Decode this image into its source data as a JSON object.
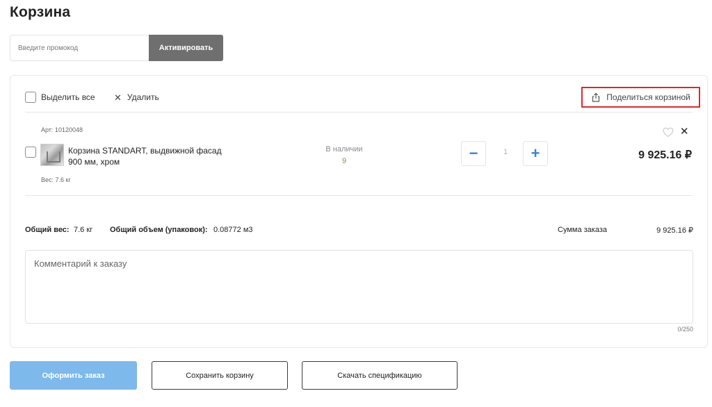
{
  "page": {
    "title": "Корзина"
  },
  "promo": {
    "placeholder": "Введите промокод",
    "button_label": "Активировать"
  },
  "toolbar": {
    "select_all_label": "Выделить все",
    "delete_label": "Удалить",
    "share_label": "Поделиться корзиной"
  },
  "item": {
    "article": "Арт: 10120048",
    "name": "Корзина STANDART, выдвижной фасад 900 мм, хром",
    "weight": "Вес: 7.6 кг",
    "stock_status": "В наличии",
    "stock_count": "9",
    "quantity": "1",
    "price": "9 925.16 ₽",
    "icons": {
      "favorite": "heart-outline-icon",
      "remove": "close-icon"
    }
  },
  "summary": {
    "weight_label": "Общий вес:",
    "weight_value": "7.6 кг",
    "volume_label": "Общий объем (упаковок):",
    "volume_value": "0.08772 м3",
    "total_label": "Сумма заказа",
    "total_value": "9 925.16 ₽"
  },
  "comment": {
    "placeholder": "Комментарий к заказу",
    "counter": "0/250"
  },
  "actions": {
    "checkout_label": "Оформить заказ",
    "save_label": "Сохранить корзину",
    "download_label": "Скачать спецификацию"
  },
  "colors": {
    "accent_blue": "#3e82d3",
    "checkout_button": "#7db9ea",
    "promo_button": "#6f6f6f",
    "share_highlight": "#e2262b",
    "stock_count": "#8a8f55"
  }
}
